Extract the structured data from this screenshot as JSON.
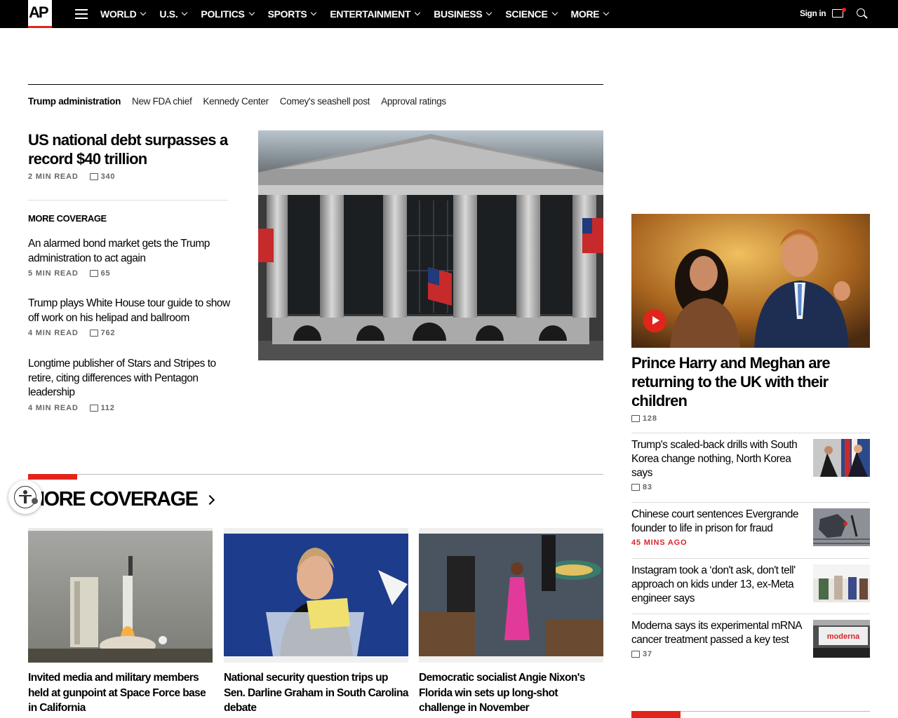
{
  "brand": {
    "logo": "AP",
    "accent": "#e1251b"
  },
  "nav": {
    "items": [
      {
        "label": "WORLD"
      },
      {
        "label": "U.S."
      },
      {
        "label": "POLITICS"
      },
      {
        "label": "SPORTS"
      },
      {
        "label": "ENTERTAINMENT"
      },
      {
        "label": "BUSINESS"
      },
      {
        "label": "SCIENCE"
      },
      {
        "label": "MORE"
      }
    ],
    "signin": "Sign in"
  },
  "tags": [
    "Trump administration",
    "New FDA chief",
    "Kennedy Center",
    "Comey's seashell post",
    "Approval ratings"
  ],
  "lead": {
    "title": "US national debt surpasses a record $40 trillion",
    "read": "2 MIN READ",
    "comments": "340"
  },
  "more_coverage_label": "MORE COVERAGE",
  "related": [
    {
      "title": "An alarmed bond market gets the Trump administration to act again",
      "read": "5 MIN READ",
      "comments": "65"
    },
    {
      "title": "Trump plays White House tour guide to show off work on his helipad and ballroom",
      "read": "4 MIN READ",
      "comments": "762"
    },
    {
      "title": "Longtime publisher of Stars and Stripes to retire, citing differences with Pentagon leadership",
      "read": "4 MIN READ",
      "comments": "112"
    }
  ],
  "right": {
    "feature": {
      "title": "Prince Harry and Meghan are returning to the UK with their children",
      "comments": "128"
    },
    "stories": [
      {
        "title": "Trump's scaled-back drills with South Korea change nothing, North Korea says",
        "meta": "83",
        "meta_type": "comments"
      },
      {
        "title": "Chinese court sentences Evergrande founder to life in prison for fraud",
        "meta": "45 MINS AGO",
        "meta_type": "time"
      },
      {
        "title": "Instagram took a ‘don't ask, don't tell' approach on kids under 13, ex-Meta engineer says",
        "meta": "",
        "meta_type": "none"
      },
      {
        "title": "Moderna says its experimental mRNA cancer treatment passed a key test",
        "meta": "37",
        "meta_type": "comments"
      }
    ],
    "moderna_sign": "moderna"
  },
  "section": {
    "title": "MORE COVERAGE",
    "cards": [
      {
        "title": "Invited media and military members held at gunpoint at Space Force base in California"
      },
      {
        "title": "National security question trips up Sen. Darline Graham in South Carolina debate"
      },
      {
        "title": "Democratic socialist Angie Nixon's Florida win sets up long-shot challenge in November"
      }
    ]
  }
}
